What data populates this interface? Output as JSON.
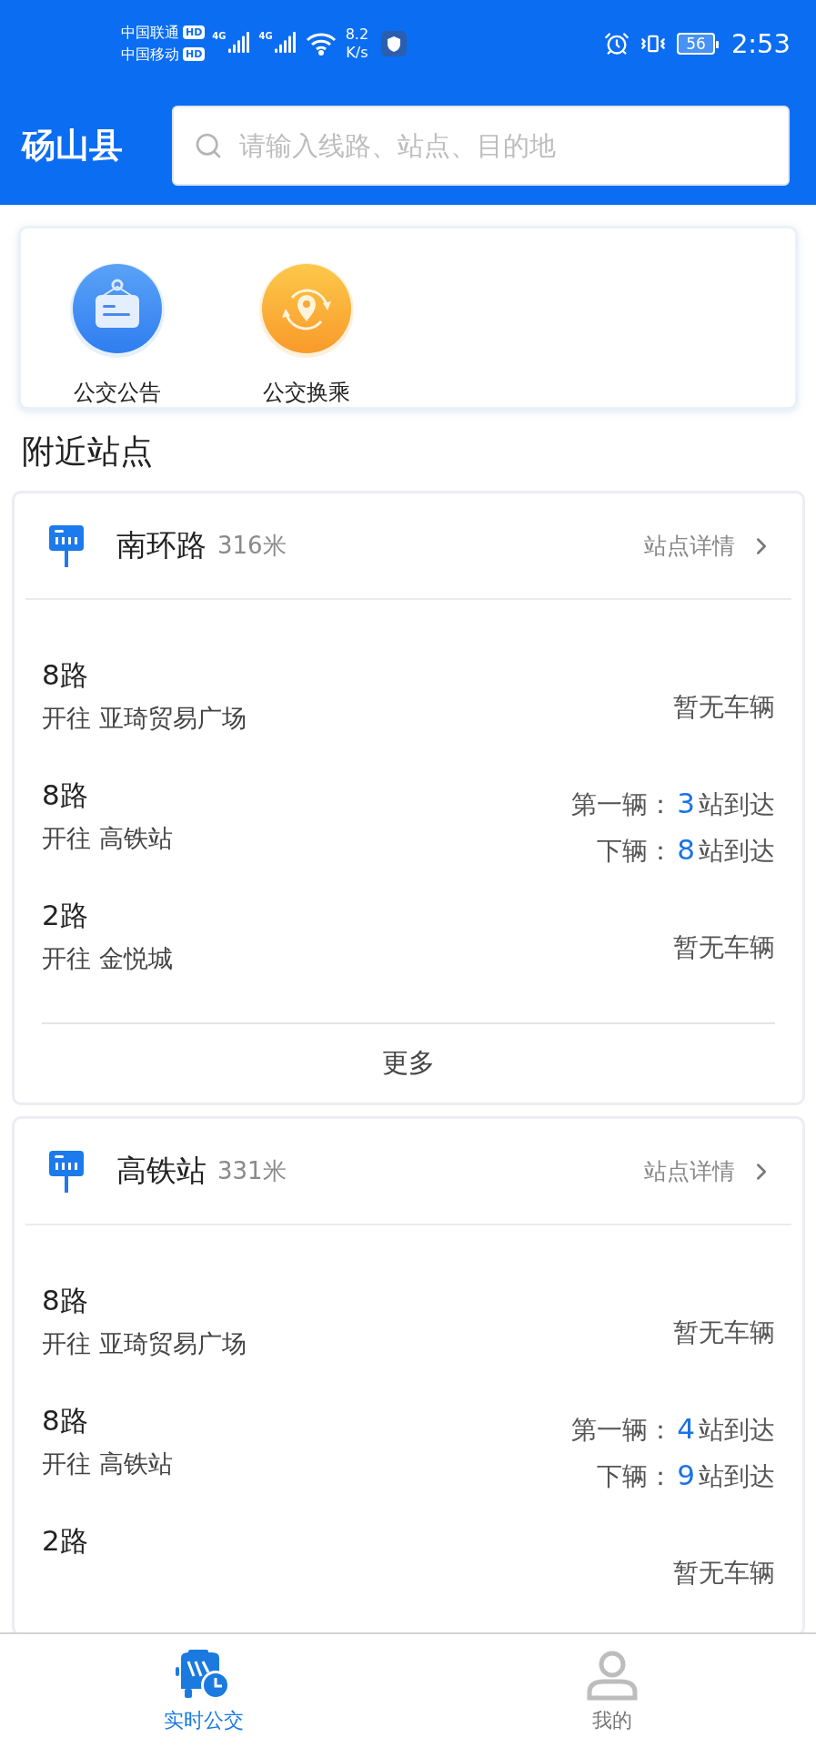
{
  "status_bar": {
    "carriers": [
      {
        "name": "中国联通",
        "badge": "HD"
      },
      {
        "name": "中国移动",
        "badge": "HD"
      }
    ],
    "networks": [
      "4G",
      "4G"
    ],
    "speed": {
      "value": "8.2",
      "unit": "K/s"
    },
    "battery": "56",
    "time": "2:53"
  },
  "header": {
    "city": "砀山县",
    "search": {
      "placeholder": "请输入线路、站点、目的地"
    }
  },
  "shortcuts": [
    {
      "kind": "notice",
      "label": "公交公告"
    },
    {
      "kind": "transfer",
      "label": "公交换乘"
    }
  ],
  "section_title": "附近站点",
  "stations": [
    {
      "name": "南环路",
      "distance": "316米",
      "detail_link": "站点详情",
      "more": "更多",
      "routes": [
        {
          "route": "8路",
          "destination": "开往 亚琦贸易广场",
          "kind": "none",
          "status": "暂无车辆"
        },
        {
          "route": "8路",
          "destination": "开往 高铁站",
          "kind": "arrival",
          "arrivals": [
            {
              "label": "第一辆：",
              "count": "3",
              "unit": "站到达"
            },
            {
              "label": "下辆：",
              "count": "8",
              "unit": "站到达"
            }
          ]
        },
        {
          "route": "2路",
          "destination": "开往 金悦城",
          "kind": "none",
          "status": "暂无车辆"
        }
      ]
    },
    {
      "name": "高铁站",
      "distance": "331米",
      "detail_link": "站点详情",
      "routes": [
        {
          "route": "8路",
          "destination": "开往 亚琦贸易广场",
          "kind": "none",
          "status": "暂无车辆"
        },
        {
          "route": "8路",
          "destination": "开往 高铁站",
          "kind": "arrival",
          "arrivals": [
            {
              "label": "第一辆：",
              "count": "4",
              "unit": "站到达"
            },
            {
              "label": "下辆：",
              "count": "9",
              "unit": "站到达"
            }
          ]
        },
        {
          "route": "2路",
          "kind": "none",
          "status": "暂无车辆"
        }
      ]
    }
  ],
  "tab_bar": [
    {
      "kind": "bus",
      "label": "实时公交",
      "selected": true
    },
    {
      "kind": "user",
      "label": "我的",
      "selected": false
    }
  ]
}
